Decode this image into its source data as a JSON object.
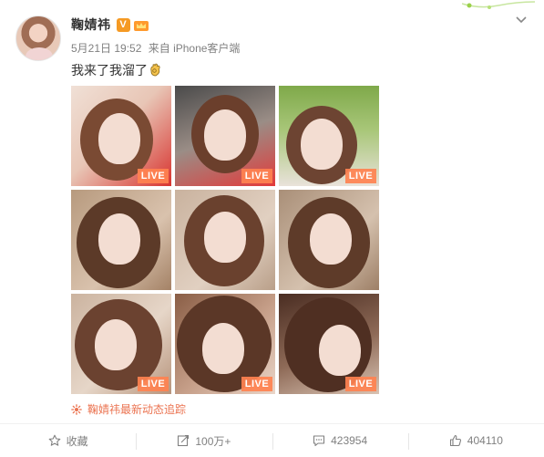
{
  "post": {
    "username": "鞠婧祎",
    "vip_badge": "V",
    "date": "5月21日 19:52",
    "source": "来自 iPhone客户端",
    "text": "我来了我溜了",
    "live_label": "LIVE",
    "tracker_text": "鞠婧祎最新动态追踪"
  },
  "photos": [
    {
      "live": true
    },
    {
      "live": true
    },
    {
      "live": true
    },
    {
      "live": false
    },
    {
      "live": false
    },
    {
      "live": false
    },
    {
      "live": true
    },
    {
      "live": true
    },
    {
      "live": true
    }
  ],
  "footer": {
    "favorite_label": "收藏",
    "repost_count": "100万+",
    "comment_count": "423954",
    "like_count": "404110"
  },
  "colors": {
    "accent": "#eb7350",
    "live_badge": "#ff8250",
    "vip": "#f59a23"
  },
  "icons": [
    "chevron-down-icon",
    "vip-icon",
    "crown-icon",
    "ok-hand-icon",
    "tracker-icon",
    "favorite-icon",
    "repost-icon",
    "comment-icon",
    "like-icon"
  ]
}
